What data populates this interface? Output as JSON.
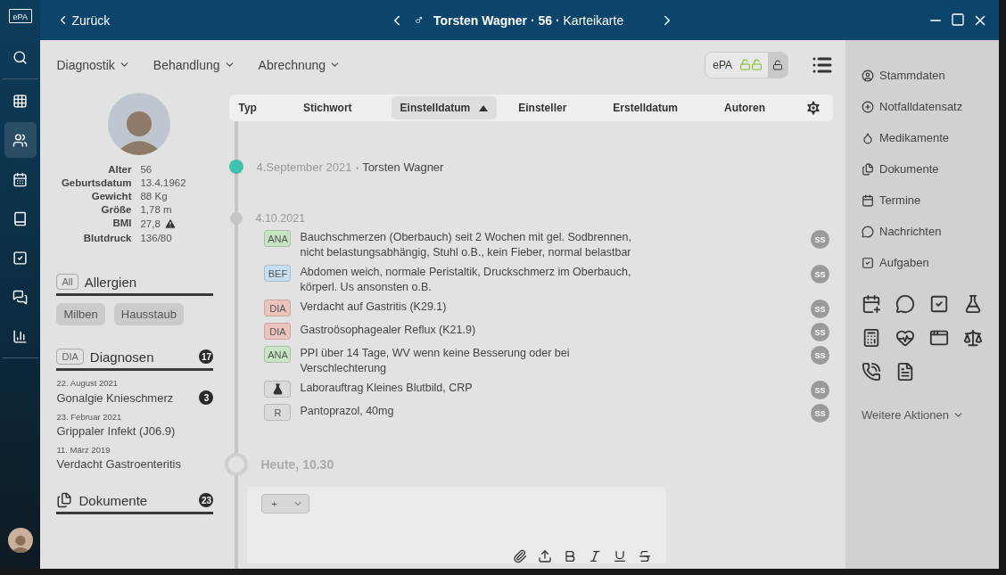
{
  "rail": {
    "logo": "ePA",
    "items": [
      {
        "selected": false
      },
      {
        "selected": false
      },
      {
        "selected": true
      },
      {
        "selected": false
      },
      {
        "selected": false
      },
      {
        "selected": false
      },
      {
        "selected": false
      },
      {
        "selected": false
      }
    ]
  },
  "header": {
    "back": "Zurück",
    "gender": "♂",
    "title": "**Torsten Wagner · 56 ·** Karteikarte"
  },
  "menus": [
    "Diagnostik",
    "Behandlung",
    "Abrechnung"
  ],
  "epa": {
    "label": "ePA"
  },
  "columns": [
    {
      "label": "Typ",
      "selected": false
    },
    {
      "label": "Stichwort",
      "selected": false
    },
    {
      "label": "Einstelldatum",
      "selected": true
    },
    {
      "label": "Einsteller",
      "selected": false
    },
    {
      "label": "Erstelldatum",
      "selected": false
    },
    {
      "label": "Autoren",
      "selected": false
    }
  ],
  "facts": [
    {
      "label": "Alter",
      "value": "56"
    },
    {
      "label": "Geburtsdatum",
      "value": "13.4.1962"
    },
    {
      "label": "Gewicht",
      "value": "88 Kg"
    },
    {
      "label": "Größe",
      "value": "1,78 m"
    },
    {
      "label": "BMI",
      "value": "27,8",
      "warning": true
    },
    {
      "label": "Blutdruck",
      "value": "136/80"
    }
  ],
  "allergies": {
    "tag": "All",
    "title": "Allergien",
    "items": [
      "Milben",
      "Hausstaub"
    ]
  },
  "diagnoses": {
    "tag": "DIA",
    "title": "Diagnosen",
    "count": "17",
    "items": [
      {
        "date": "22. August 2021",
        "name": "Gonalgie Knieschmerz",
        "count": "3"
      },
      {
        "date": "23. Februar 2021",
        "name": "Grippaler Infekt (J06.9)"
      },
      {
        "date": "11. März 2019",
        "name": "Verdacht Gastroenteritis"
      }
    ]
  },
  "documents": {
    "title": "Dokumente",
    "count": "23"
  },
  "timeline": {
    "event": {
      "date": "4.September 2021",
      "author": "· Torsten Wagner"
    },
    "group_date": "4.10.2021",
    "entries": [
      {
        "kind": "tag",
        "tag": "ANA",
        "color": "#c9e4c4",
        "text": "Bauchschmerzen (Oberbauch) seit 2 Wochen mit gel. Sodbrennen, nicht belastungsabhängig, Stuhl o.B., kein Fieber, normal belastbar",
        "author": "SS"
      },
      {
        "kind": "tag",
        "tag": "BEF",
        "color": "#c6dff3",
        "text": "Abdomen weich, normale Peristaltik, Druckschmerz im Oberbauch, körperl. Us ansonsten o.B.",
        "author": "SS"
      },
      {
        "kind": "tag",
        "tag": "DIA",
        "color": "#edc3be",
        "text": "Verdacht auf Gastritis (K29.1)",
        "author": "SS"
      },
      {
        "kind": "tag",
        "tag": "DIA",
        "color": "#edc3be",
        "text": "Gastroösophagealer Reflux (K21.9)",
        "author": "SS"
      },
      {
        "kind": "tag",
        "tag": "ANA",
        "color": "#c9e4c4",
        "text": "PPI über 14 Tage, WV wenn keine Besserung oder bei Verschlechterung",
        "author": "SS"
      },
      {
        "kind": "lab",
        "color": "#dadada",
        "text": "Laborauftrag Kleines Blutbild, CRP",
        "author": "SS"
      },
      {
        "kind": "tag",
        "tag": "R",
        "color": "#dadada",
        "text": "Pantoprazol, 40mg",
        "author": "SS"
      }
    ],
    "today": "Heute, 10.30",
    "add": "+"
  },
  "links": [
    "Stammdaten",
    "Notfalldatensatz",
    "Medikamente",
    "Dokumente",
    "Termine",
    "Nachrichten",
    "Aufgaben"
  ],
  "more": "Weitere Aktionen"
}
